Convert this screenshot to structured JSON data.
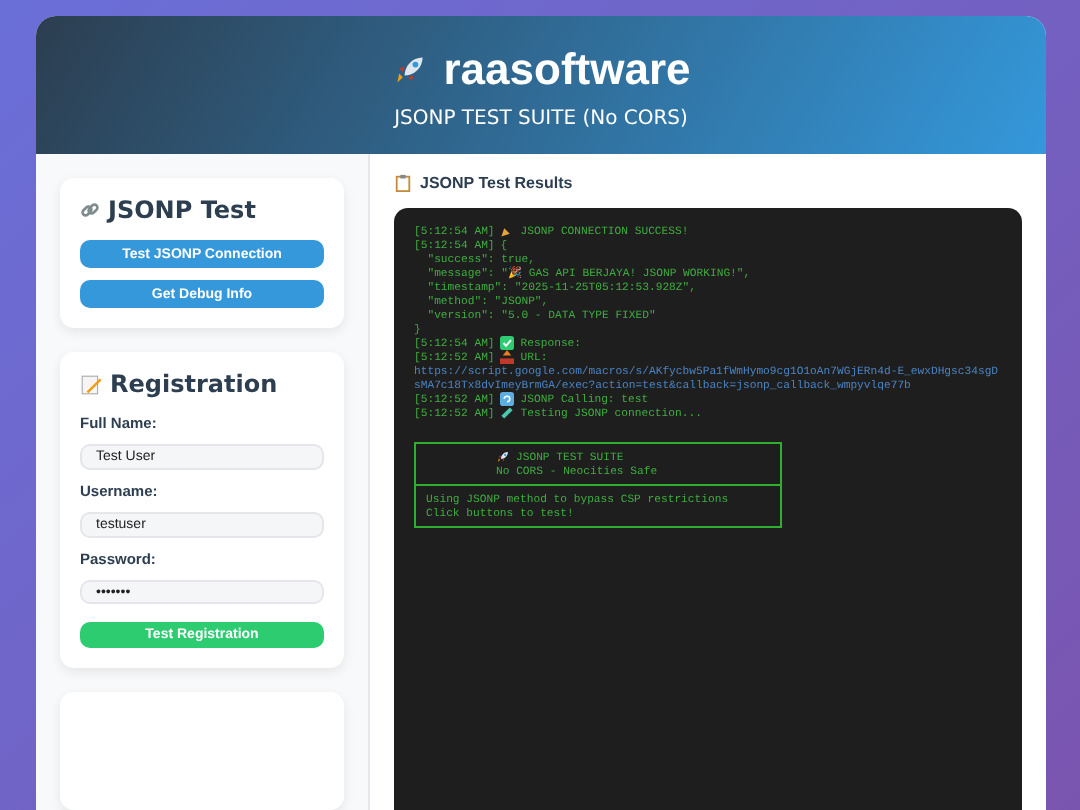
{
  "header": {
    "title": "raasoftware",
    "subtitle": "JSONP TEST SUITE (No CORS)"
  },
  "jsonp_card": {
    "title": "JSONP Test",
    "buttons": [
      {
        "label": "Test JSONP Connection"
      },
      {
        "label": "Get Debug Info"
      }
    ]
  },
  "registration_card": {
    "title": "Registration",
    "fields": [
      {
        "label": "Full Name:",
        "value": "Test User"
      },
      {
        "label": "Username:",
        "value": "testuser"
      },
      {
        "label": "Password:",
        "value": "•••••••"
      }
    ],
    "submit": "Test Registration"
  },
  "results": {
    "title": "JSONP Test Results",
    "lines": [
      {
        "kind": "success",
        "time": "[5:12:54 AM]",
        "text": "JSONP CONNECTION SUCCESS!"
      },
      {
        "kind": "plain",
        "time": "[5:12:54 AM]",
        "text": "{"
      },
      {
        "kind": "json",
        "text": "  \"success\": true,"
      },
      {
        "kind": "json",
        "text": "  \"message\": \"🎉 GAS API BERJAYA! JSONP WORKING!\","
      },
      {
        "kind": "json",
        "text": "  \"timestamp\": \"2025-11-25T05:12:53.928Z\","
      },
      {
        "kind": "json",
        "text": "  \"method\": \"JSONP\","
      },
      {
        "kind": "json",
        "text": "  \"version\": \"5.0 - DATA TYPE FIXED\""
      },
      {
        "kind": "json",
        "text": "}"
      },
      {
        "kind": "response",
        "time": "[5:12:54 AM]",
        "text": "Response:"
      },
      {
        "kind": "outgoing",
        "time": "[5:12:52 AM]",
        "text": "URL:"
      },
      {
        "kind": "url",
        "text": "https://script.google.com/macros/s/AKfycbw5Pa1fWmHymo9cg1O1oAn7WGjERn4d-E_ewxDHgsc34sgDsMA7c18Tx8dvImeyBrmGA/exec?action=test&callback=jsonp_callback_wmpyvlqe77b"
      },
      {
        "kind": "calling",
        "time": "[5:12:52 AM]",
        "text": "JSONP Calling: test"
      },
      {
        "kind": "testing",
        "time": "[5:12:52 AM]",
        "text": "Testing JSONP connection..."
      }
    ],
    "banner": {
      "title": "JSONP TEST SUITE",
      "subtitle": "No CORS - Neocities Safe",
      "lines": [
        "Using JSONP method to bypass CSP restrictions",
        "Click buttons to test!"
      ]
    }
  }
}
